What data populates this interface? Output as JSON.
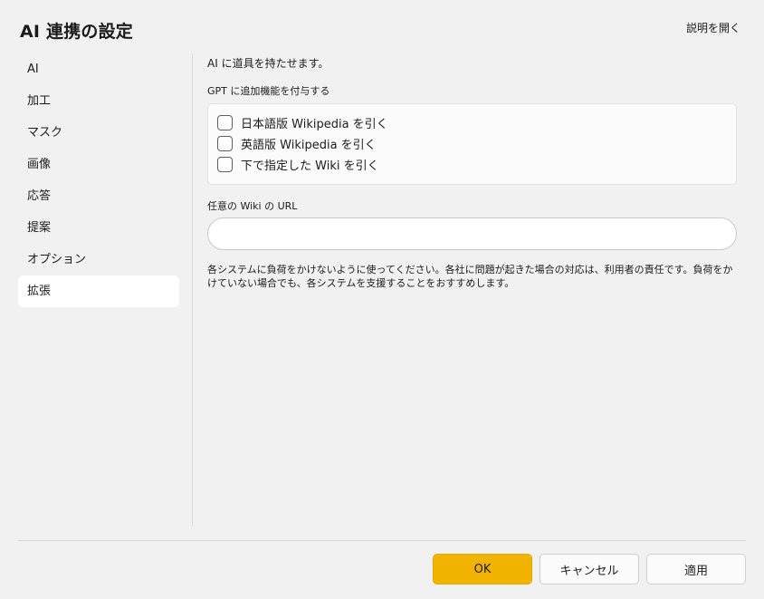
{
  "window": {
    "title": "AI 連携の設定",
    "help_link": "説明を開く"
  },
  "sidebar": {
    "items": [
      {
        "label": "AI",
        "active": false
      },
      {
        "label": "加工",
        "active": false
      },
      {
        "label": "マスク",
        "active": false
      },
      {
        "label": "画像",
        "active": false
      },
      {
        "label": "応答",
        "active": false
      },
      {
        "label": "提案",
        "active": false
      },
      {
        "label": "オプション",
        "active": false
      },
      {
        "label": "拡張",
        "active": true
      }
    ]
  },
  "content": {
    "intro": "AI に道具を持たせます。",
    "gpt_group_label": "GPT に追加機能を付与する",
    "checkboxes": [
      {
        "label": "日本語版 Wikipedia を引く",
        "checked": false
      },
      {
        "label": "英語版 Wikipedia を引く",
        "checked": false
      },
      {
        "label": "下で指定した Wiki を引く",
        "checked": false
      }
    ],
    "url_label": "任意の Wiki の URL",
    "url_value": "",
    "url_placeholder": "",
    "notice": "各システムに負荷をかけないように使ってください。各社に問題が起きた場合の対応は、利用者の責任です。負荷をかけていない場合でも、各システムを支援することをおすすめします。"
  },
  "footer": {
    "ok_label": "OK",
    "cancel_label": "キャンセル",
    "apply_label": "適用"
  },
  "colors": {
    "accent": "#f2b300",
    "background": "#f1f1f1"
  }
}
